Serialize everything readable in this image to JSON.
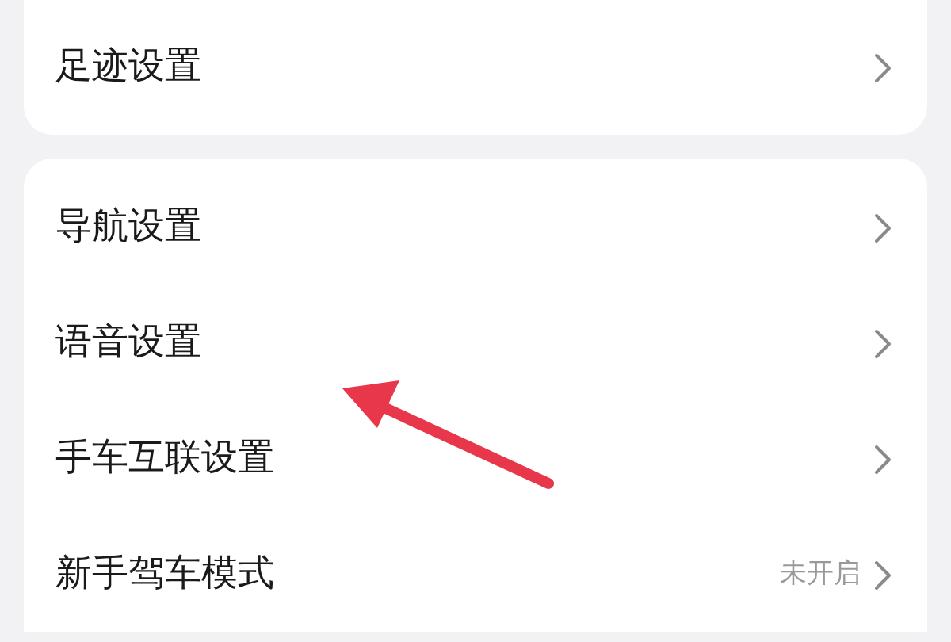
{
  "groups": [
    {
      "cut_top": true,
      "items": [
        {
          "label": "足迹设置"
        }
      ]
    },
    {
      "cut_top": false,
      "items": [
        {
          "label": "导航设置"
        },
        {
          "label": "语音设置"
        },
        {
          "label": "手车互联设置"
        },
        {
          "label": "新手驾车模式",
          "value": "未开启"
        }
      ]
    }
  ],
  "annotation": {
    "kind": "arrow",
    "color": "#e8364a"
  }
}
